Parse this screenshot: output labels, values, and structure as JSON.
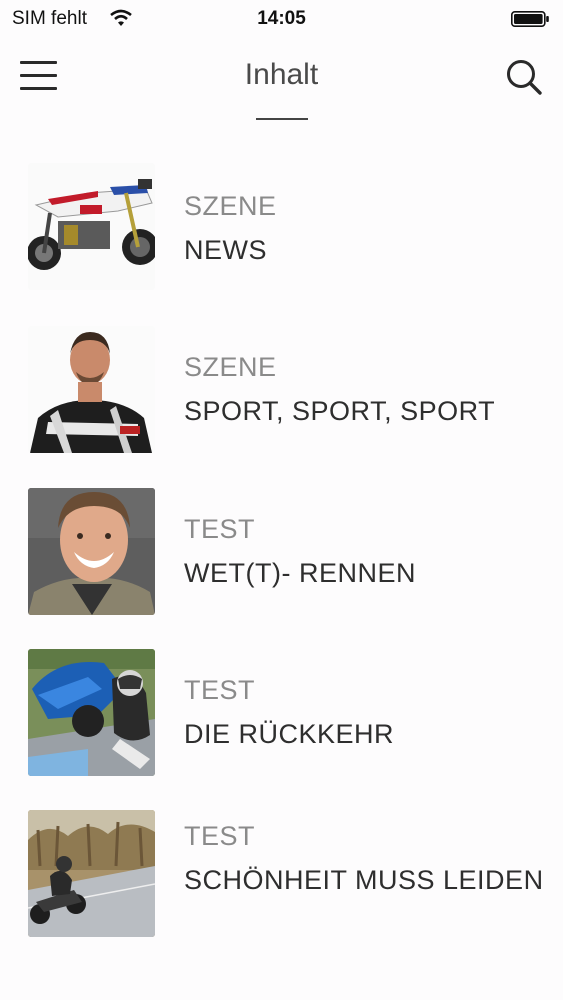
{
  "status_bar": {
    "carrier": "SIM fehlt",
    "time": "14:05"
  },
  "nav": {
    "title": "Inhalt"
  },
  "items": [
    {
      "category": "SZENE",
      "title": "NEWS"
    },
    {
      "category": "SZENE",
      "title": "SPORT, SPORT, SPORT"
    },
    {
      "category": "TEST",
      "title": "WET(T)- RENNEN"
    },
    {
      "category": "TEST",
      "title": "DIE RÜCKKEHR"
    },
    {
      "category": "TEST",
      "title": "SCHÖNHEIT MUSS LEIDEN"
    }
  ]
}
